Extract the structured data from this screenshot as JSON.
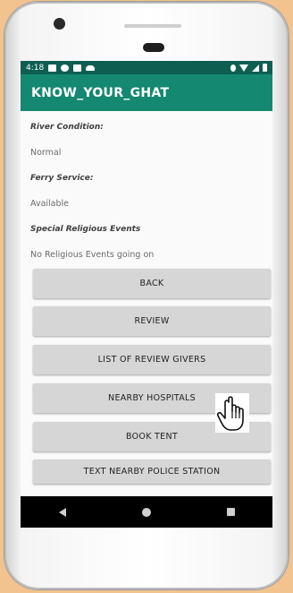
{
  "status_bar": {
    "time": "4:18"
  },
  "app_bar": {
    "title": "KNOW_YOUR_GHAT"
  },
  "details": [
    {
      "label": "River Condition:",
      "value": "Normal"
    },
    {
      "label": "Ferry Service:",
      "value": "Available"
    },
    {
      "label": "Special Religious Events",
      "value": "No Religious Events going on"
    }
  ],
  "buttons": {
    "back": "BACK",
    "review": "REVIEW",
    "review_givers": "LIST OF REVIEW GIVERS",
    "hospitals": "NEARBY HOSPITALS",
    "tent": "BOOK TENT",
    "police": "TEXT NEARBY POLICE STATION"
  },
  "colors": {
    "status_bar": "#0e5f51",
    "app_bar": "#148870",
    "button": "#d6d6d6",
    "background": "#f2c38f"
  },
  "icons": [
    "mail-icon",
    "record-icon",
    "sd-card-icon",
    "cloud-icon",
    "location-icon",
    "wifi-icon",
    "signal-icon",
    "battery-icon",
    "hand-pointer-icon"
  ]
}
